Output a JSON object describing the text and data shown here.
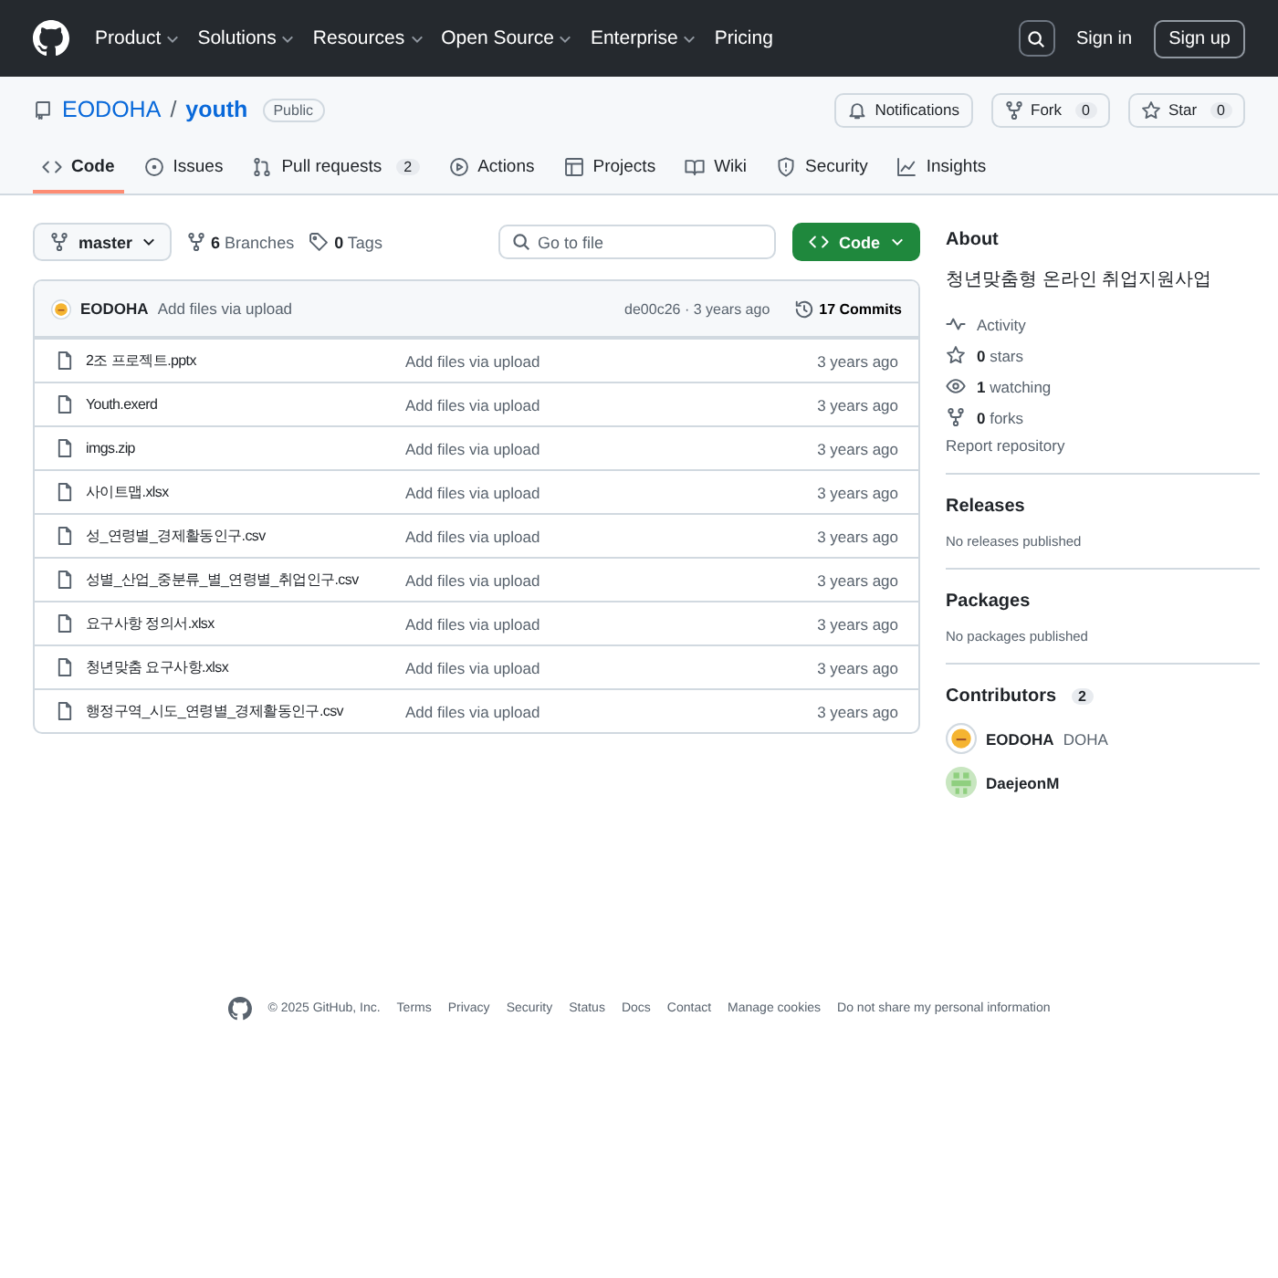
{
  "header": {
    "nav": [
      {
        "label": "Product",
        "dropdown": true
      },
      {
        "label": "Solutions",
        "dropdown": true
      },
      {
        "label": "Resources",
        "dropdown": true
      },
      {
        "label": "Open Source",
        "dropdown": true
      },
      {
        "label": "Enterprise",
        "dropdown": true
      },
      {
        "label": "Pricing",
        "dropdown": false
      }
    ],
    "sign_in": "Sign in",
    "sign_up": "Sign up"
  },
  "repo": {
    "owner": "EODOHA",
    "separator": "/",
    "name": "youth",
    "visibility": "Public",
    "actions": [
      {
        "label": "Notifications"
      },
      {
        "label": "Fork",
        "count": "0"
      },
      {
        "label": "Star",
        "count": "0"
      }
    ]
  },
  "tabs": [
    {
      "label": "Code",
      "selected": true
    },
    {
      "label": "Issues",
      "selected": false
    },
    {
      "label": "Pull requests",
      "count": "2",
      "selected": false
    },
    {
      "label": "Actions",
      "selected": false
    },
    {
      "label": "Projects",
      "selected": false
    },
    {
      "label": "Wiki",
      "selected": false
    },
    {
      "label": "Security",
      "selected": false
    },
    {
      "label": "Insights",
      "selected": false
    }
  ],
  "toolbar": {
    "branch": "master",
    "branches": "**6** Branches",
    "tags": "**0** Tags",
    "search_placeholder": "Go to file",
    "code_button": "Code"
  },
  "commit": {
    "author": "EODOHA",
    "message": "Add files via upload",
    "hash_time": "de00c26 · 3 years ago",
    "commits": "17 Commits"
  },
  "files": [
    {
      "name": "2조 프로젝트.pptx",
      "message": "Add files via upload",
      "time": "3 years ago"
    },
    {
      "name": "Youth.exerd",
      "message": "Add files via upload",
      "time": "3 years ago"
    },
    {
      "name": "imgs.zip",
      "message": "Add files via upload",
      "time": "3 years ago"
    },
    {
      "name": "사이트맵.xlsx",
      "message": "Add files via upload",
      "time": "3 years ago"
    },
    {
      "name": "성_연령별_경제활동인구.csv",
      "message": "Add files via upload",
      "time": "3 years ago"
    },
    {
      "name": "성별_산업_중분류_별_연령별_취업인구.csv",
      "message": "Add files via upload",
      "time": "3 years ago"
    },
    {
      "name": "요구사항 정의서.xlsx",
      "message": "Add files via upload",
      "time": "3 years ago"
    },
    {
      "name": "청년맞춤 요구사항.xlsx",
      "message": "Add files via upload",
      "time": "3 years ago"
    },
    {
      "name": "행정구역_시도_연령별_경제활동인구.csv",
      "message": "Add files via upload",
      "time": "3 years ago"
    }
  ],
  "about": {
    "title": "About",
    "description": "청년맞춤형 온라인 취업지원사업",
    "stats": [
      "Activity",
      "**0** stars",
      "**1** watching",
      "**0** forks"
    ],
    "report": "Report repository"
  },
  "releases": {
    "title": "Releases",
    "text": "No releases published"
  },
  "packages": {
    "title": "Packages",
    "text": "No packages published"
  },
  "contributors": {
    "title": "Contributors",
    "count": "2",
    "people": [
      {
        "login": "EODOHA",
        "name": "DOHA",
        "kind": "yellow"
      },
      {
        "login": "DaejeonM",
        "kind": "pattern"
      }
    ]
  },
  "footer": {
    "copyright": "© 2025 GitHub, Inc.",
    "links": [
      "Terms",
      "Privacy",
      "Security",
      "Status",
      "Docs",
      "Contact",
      "Manage cookies",
      "Do not share my personal information"
    ]
  }
}
